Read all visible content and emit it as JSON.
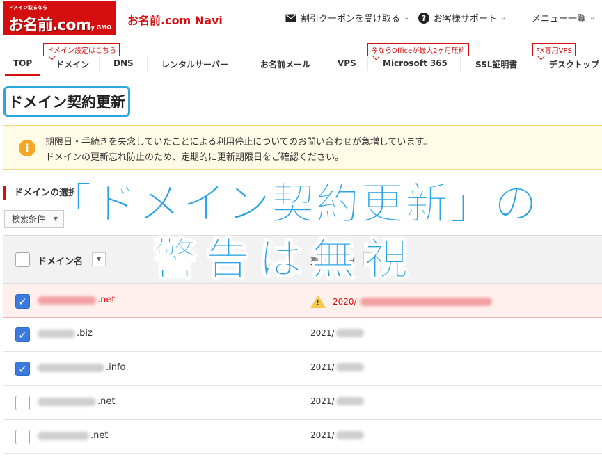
{
  "header": {
    "logo_tag": "ドメイン取るなら",
    "logo_brand": "お名前.com",
    "logo_sub": "by GMO",
    "app_title": "お名前.com Navi",
    "coupon": "割引クーポンを受け取る",
    "support": "お客様サポート",
    "menu": "メニュー一覧"
  },
  "nav": {
    "items": [
      "TOP",
      "ドメイン",
      "DNS",
      "レンタルサーバー",
      "お名前メール",
      "VPS",
      "Microsoft 365",
      "SSL証明書",
      "デスクトップ"
    ],
    "badges": [
      "ドメイン設定はこちら",
      "今ならOfficeが最大2ヶ月無料",
      "FX専用VPS"
    ]
  },
  "page_title": "ドメイン契約更新",
  "alert": {
    "line1": "期限日・手続きを失念していたことによる利用停止についてのお問い合わせが急増しています。",
    "line2": "ドメインの更新忘れ防止のため、定期的に更新期限日をご確認ください。"
  },
  "section_title": "ドメインの選択",
  "filter_label": "検索条件",
  "table": {
    "col_domain": "ドメイン名",
    "col_expiry": "更新期限日",
    "rows": [
      {
        "tld": ".net",
        "date": "2020/",
        "checked": true,
        "warning": true
      },
      {
        "tld": ".biz",
        "date": "2021/",
        "checked": true,
        "warning": false
      },
      {
        "tld": ".info",
        "date": "2021/",
        "checked": true,
        "warning": false
      },
      {
        "tld": ".net",
        "date": "2021/",
        "checked": false,
        "warning": false
      },
      {
        "tld": ".net",
        "date": "2021/",
        "checked": false,
        "warning": false
      }
    ]
  },
  "overlay": {
    "line1": "「ドメイン契約更新」の",
    "line2": "警告は無視"
  },
  "colors": {
    "brand": "#d50f0f",
    "accent": "#2aa3e4",
    "checkbox": "#3b7be0"
  },
  "icons": [
    "envelope-icon",
    "question-circle-icon",
    "info-icon",
    "warning-icon",
    "checkmark-icon"
  ]
}
